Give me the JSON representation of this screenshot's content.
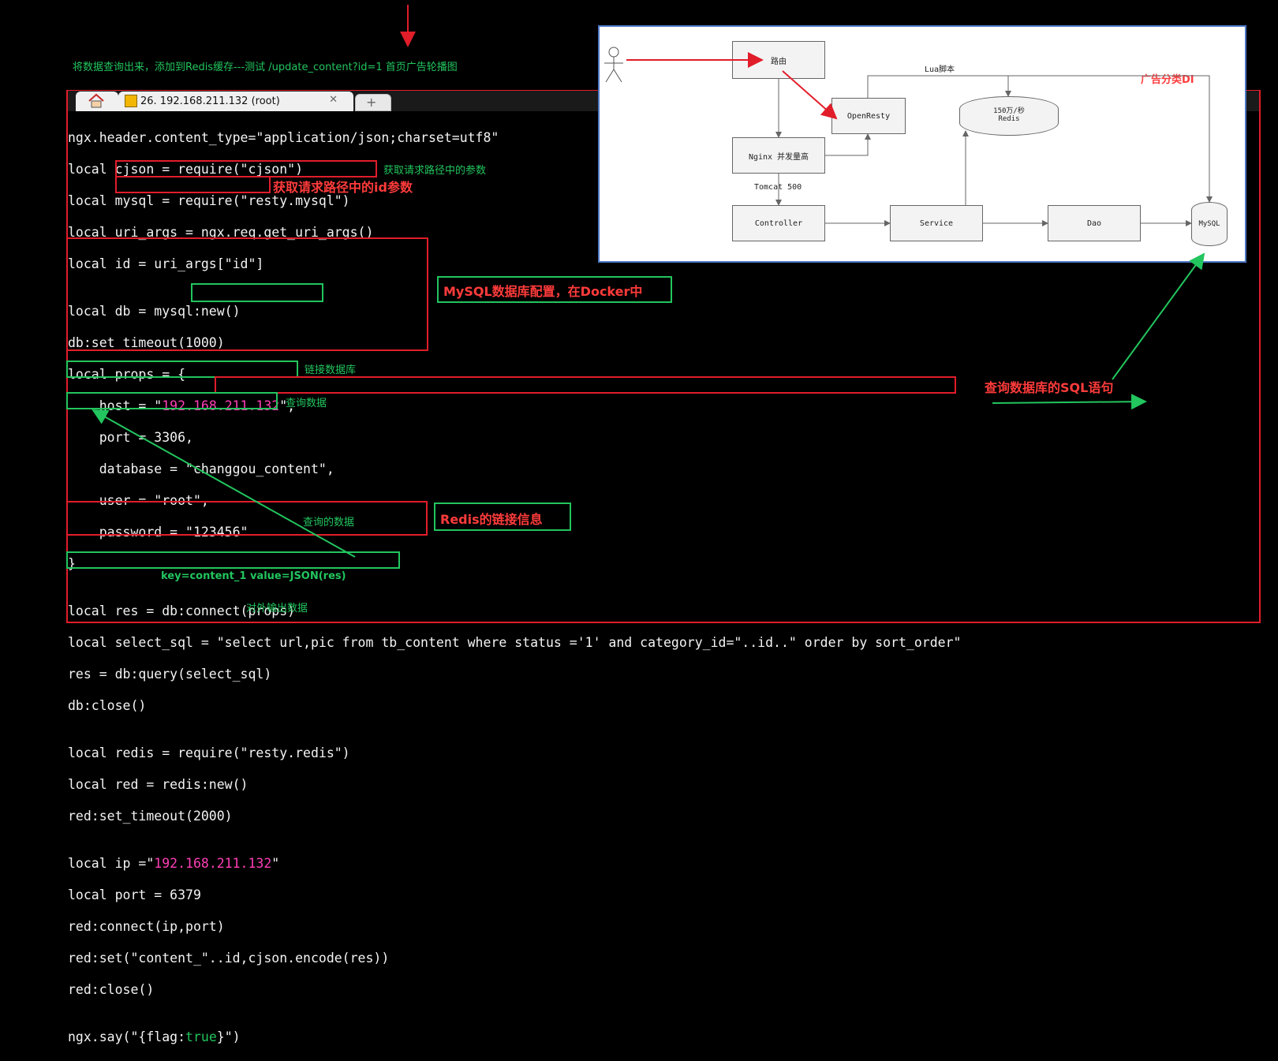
{
  "top_annotation": "将数据查询出来，添加到Redis缓存---测试 /update_content?id=1 首页广告轮播图",
  "terminal": {
    "tab_title": "26. 192.168.211.132 (root)",
    "code_lines": [
      "ngx.header.content_type=\"application/json;charset=utf8\"",
      "local cjson = require(\"cjson\")",
      "local mysql = require(\"resty.mysql\")",
      "local uri_args = ngx.req.get_uri_args()",
      "local id = uri_args[\"id\"]",
      "",
      "local db = mysql:new()",
      "db:set_timeout(1000)",
      "local props = {",
      "    host = \"192.168.211.132\",",
      "    port = 3306,",
      "    database = \"changgou_content\",",
      "    user = \"root\",",
      "    password = \"123456\"",
      "}",
      "",
      "local res = db:connect(props)",
      "local select_sql = \"select url,pic from tb_content where status ='1' and category_id=\"..id..\" order by sort_order\"",
      "res = db:query(select_sql)",
      "db:close()",
      "",
      "local redis = require(\"resty.redis\")",
      "local red = redis:new()",
      "red:set_timeout(2000)",
      "",
      "local ip =\"192.168.211.132\"",
      "local port = 6379",
      "red:connect(ip,port)",
      "red:set(\"content_\"..id,cjson.encode(res))",
      "red:close()",
      "",
      "ngx.say(\"{flag:true}\")"
    ]
  },
  "annotations": {
    "uri_args": "获取请求路径中的参数",
    "id": "获取请求路径中的id参数",
    "mysql": "MySQL数据库配置，在Docker中",
    "connect": "链接数据库",
    "sql": "查询数据库的SQL语句",
    "query": "查询数据",
    "queried": "查询的数据",
    "redis": "Redis的链接信息",
    "kv": "key=content_1 value=JSON(res)",
    "output": "对外输出数据"
  },
  "diagram": {
    "router": "路由",
    "openresty": "OpenResty",
    "lua": "Lua脚本",
    "redis_top": "150万/秒",
    "redis_bottom": "Redis",
    "nginx": "Nginx  并发量高",
    "tomcat": "Tomcat  500",
    "controller": "Controller",
    "service": "Service",
    "dao": "Dao",
    "mysql": "MySQL",
    "ad_label": "广告分类DI"
  },
  "colors": {
    "red": "#e11d2a",
    "green": "#22c55e",
    "pink": "#ff3fb7"
  }
}
